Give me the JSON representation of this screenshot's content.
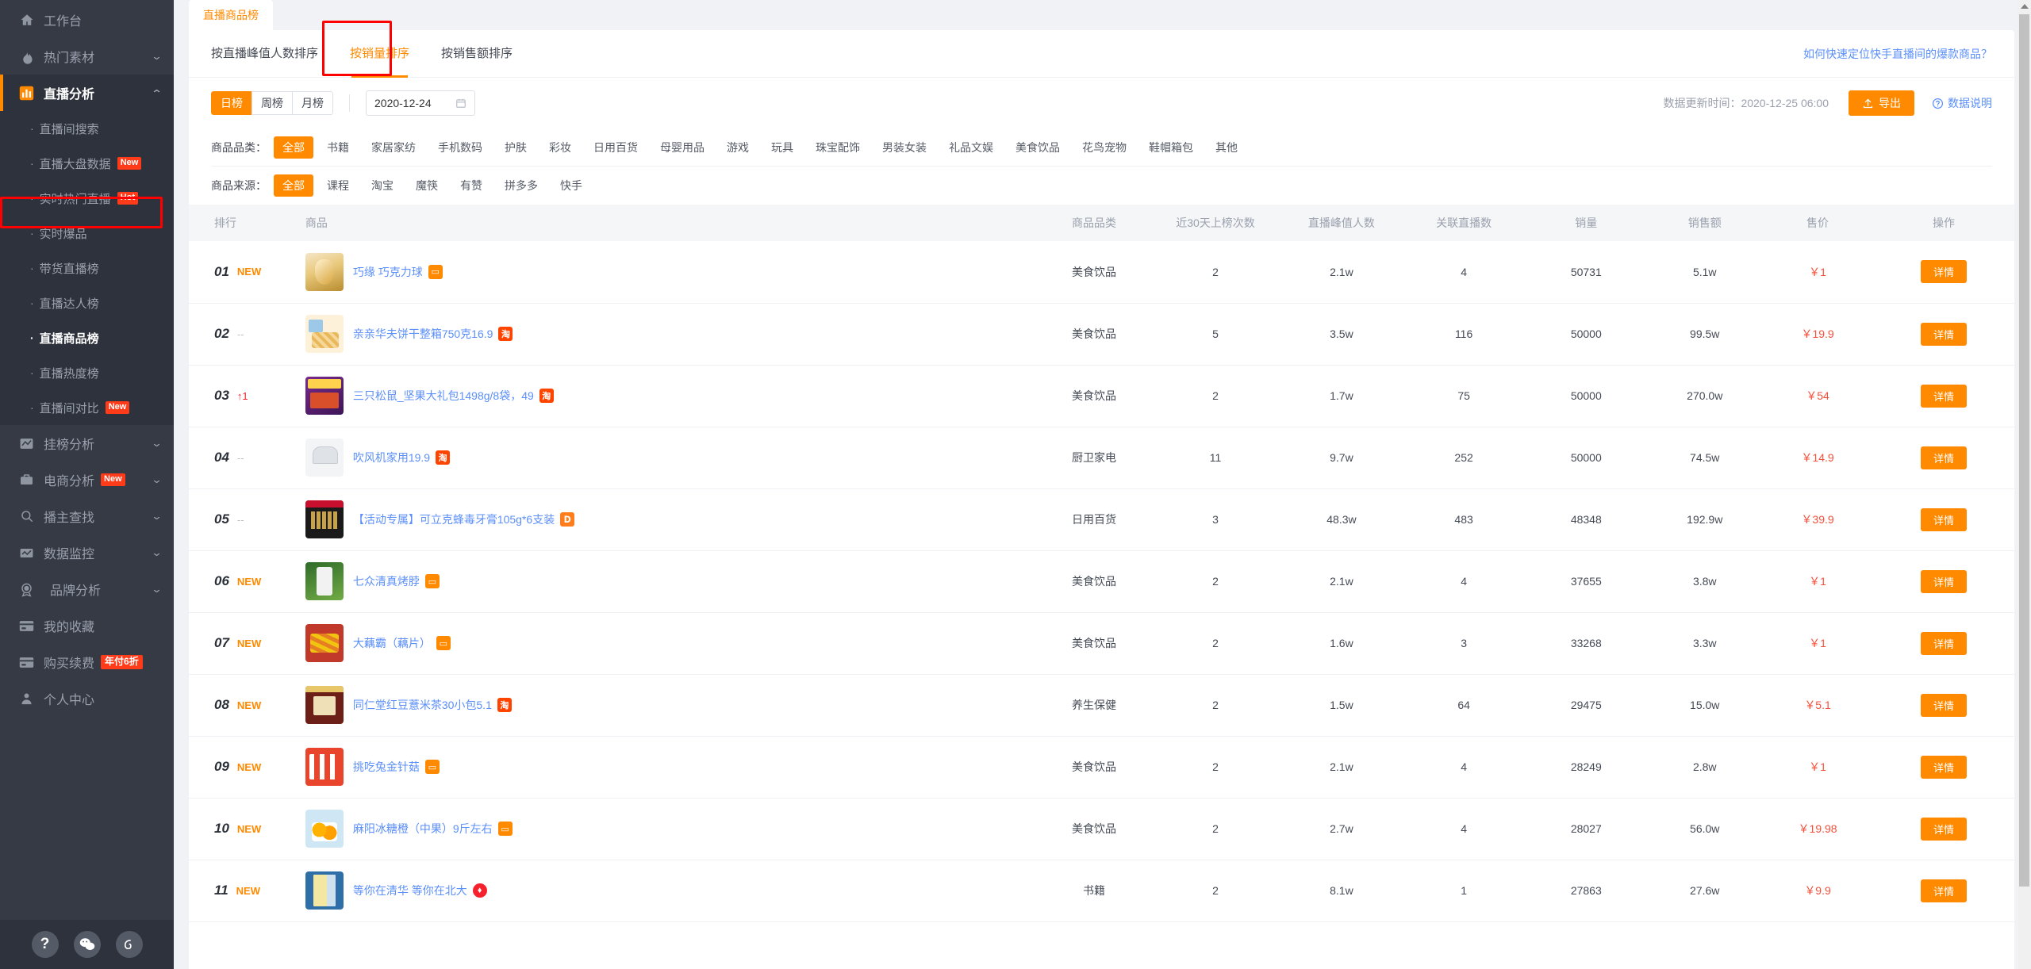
{
  "sidebar": {
    "items": [
      {
        "label": "工作台",
        "icon": "home-icon",
        "type": "group",
        "caret": false
      },
      {
        "label": "热门素材",
        "icon": "fire-icon",
        "type": "group",
        "caret": true
      },
      {
        "label": "直播分析",
        "icon": "bar-chart-icon",
        "type": "group",
        "caret": true,
        "active": true,
        "expanded": true
      }
    ],
    "live_sub_items": [
      {
        "label": "直播间搜索",
        "badge": ""
      },
      {
        "label": "直播大盘数据",
        "badge": "New"
      },
      {
        "label": "实时热门直播",
        "badge": "Hot"
      },
      {
        "label": "实时爆品",
        "badge": ""
      },
      {
        "label": "带货直播榜",
        "badge": ""
      },
      {
        "label": "直播达人榜",
        "badge": ""
      },
      {
        "label": "直播商品榜",
        "badge": "",
        "current": true
      },
      {
        "label": "直播热度榜",
        "badge": ""
      },
      {
        "label": "直播间对比",
        "badge": "New"
      }
    ],
    "lower_items": [
      {
        "label": "挂榜分析",
        "icon": "trend-icon",
        "badge": "",
        "caret": true
      },
      {
        "label": "电商分析",
        "icon": "briefcase-icon",
        "badge": "New",
        "caret": true
      },
      {
        "label": "播主查找",
        "icon": "search-icon",
        "badge": "",
        "caret": true
      },
      {
        "label": "数据监控",
        "icon": "monitor-icon",
        "badge": "",
        "caret": true
      },
      {
        "label": "品牌分析",
        "icon": "medal-icon",
        "badge": "",
        "caret": true
      },
      {
        "label": "我的收藏",
        "icon": "card-icon",
        "badge": "",
        "caret": false
      },
      {
        "label": "购买续费",
        "icon": "card-icon",
        "badge": "年付6折",
        "caret": false
      },
      {
        "label": "个人中心",
        "icon": "user-icon",
        "badge": "",
        "caret": false
      }
    ],
    "bottom_buttons": [
      {
        "name": "help-icon",
        "glyph": "?"
      },
      {
        "name": "wechat-icon",
        "glyph": ""
      },
      {
        "name": "link-icon",
        "glyph": ""
      }
    ]
  },
  "doc_tab": {
    "label": "直播商品榜"
  },
  "subtabs": [
    {
      "label": "按直播峰值人数排序",
      "active": false
    },
    {
      "label": "按销量排序",
      "active": true,
      "highlighted": true
    },
    {
      "label": "按销售额排序",
      "active": false
    }
  ],
  "help_link": "如何快速定位快手直播间的爆款商品？",
  "period": {
    "options": [
      {
        "label": "日榜",
        "active": true
      },
      {
        "label": "周榜",
        "active": false
      },
      {
        "label": "月榜",
        "active": false
      }
    ],
    "date_value": "2020-12-24"
  },
  "updated": {
    "text": "数据更新时间：2020-12-25 06:00",
    "export_label": "导出",
    "explain_label": "数据说明"
  },
  "filters": {
    "category": {
      "label": "商品品类：",
      "options": [
        "全部",
        "书籍",
        "家居家纺",
        "手机数码",
        "护肤",
        "彩妆",
        "日用百货",
        "母婴用品",
        "游戏",
        "玩具",
        "珠宝配饰",
        "男装女装",
        "礼品文娱",
        "美食饮品",
        "花鸟宠物",
        "鞋帽箱包",
        "其他"
      ],
      "selected": "全部"
    },
    "source": {
      "label": "商品来源：",
      "options": [
        "全部",
        "课程",
        "淘宝",
        "魔筷",
        "有赞",
        "拼多多",
        "快手"
      ],
      "selected": "全部"
    }
  },
  "table": {
    "headers": [
      "排行",
      "商品",
      "商品品类",
      "近30天上榜次数",
      "直播峰值人数",
      "关联直播数",
      "销量",
      "销售额",
      "售价",
      "操作"
    ],
    "action_label": "详情",
    "rows": [
      {
        "rank": "01",
        "delta": "NEW",
        "delta_type": "new",
        "name": "巧缘 巧克力球",
        "src": "shop",
        "src_glyph": "▭",
        "thumb": "t1",
        "category": "美食饮品",
        "times": "2",
        "peak": "2.1w",
        "related": "4",
        "sales": "50731",
        "amount": "5.1w",
        "price": "￥1"
      },
      {
        "rank": "02",
        "delta": "--",
        "delta_type": "dash",
        "name": "亲亲华夫饼干整箱750克16.9",
        "src": "tao",
        "src_glyph": "淘",
        "thumb": "t2",
        "category": "美食饮品",
        "times": "5",
        "peak": "3.5w",
        "related": "116",
        "sales": "50000",
        "amount": "99.5w",
        "price": "￥19.9"
      },
      {
        "rank": "03",
        "delta": "↑1",
        "delta_type": "up",
        "name": "三只松鼠_坚果大礼包1498g/8袋，49",
        "src": "tao",
        "src_glyph": "淘",
        "thumb": "t3",
        "category": "美食饮品",
        "times": "2",
        "peak": "1.7w",
        "related": "75",
        "sales": "50000",
        "amount": "270.0w",
        "price": "￥54"
      },
      {
        "rank": "04",
        "delta": "--",
        "delta_type": "dash",
        "name": "吹风机家用19.9",
        "src": "tao",
        "src_glyph": "淘",
        "thumb": "t4",
        "category": "厨卫家电",
        "times": "11",
        "peak": "9.7w",
        "related": "252",
        "sales": "50000",
        "amount": "74.5w",
        "price": "￥14.9"
      },
      {
        "rank": "05",
        "delta": "--",
        "delta_type": "dash",
        "name": "【活动专属】可立克蜂毒牙膏105g*6支装",
        "src": "mo",
        "src_glyph": "ᗞ",
        "thumb": "t5",
        "category": "日用百货",
        "times": "3",
        "peak": "48.3w",
        "related": "483",
        "sales": "48348",
        "amount": "192.9w",
        "price": "￥39.9"
      },
      {
        "rank": "06",
        "delta": "NEW",
        "delta_type": "new",
        "name": "七众清真烤脖",
        "src": "shop",
        "src_glyph": "▭",
        "thumb": "t6",
        "category": "美食饮品",
        "times": "2",
        "peak": "2.1w",
        "related": "4",
        "sales": "37655",
        "amount": "3.8w",
        "price": "￥1"
      },
      {
        "rank": "07",
        "delta": "NEW",
        "delta_type": "new",
        "name": "大藕霸（藕片）",
        "src": "shop",
        "src_glyph": "▭",
        "thumb": "t7",
        "category": "美食饮品",
        "times": "2",
        "peak": "1.6w",
        "related": "3",
        "sales": "33268",
        "amount": "3.3w",
        "price": "￥1"
      },
      {
        "rank": "08",
        "delta": "NEW",
        "delta_type": "new",
        "name": "同仁堂红豆薏米茶30小包5.1",
        "src": "tao",
        "src_glyph": "淘",
        "thumb": "t8",
        "category": "养生保健",
        "times": "2",
        "peak": "1.5w",
        "related": "64",
        "sales": "29475",
        "amount": "15.0w",
        "price": "￥5.1"
      },
      {
        "rank": "09",
        "delta": "NEW",
        "delta_type": "new",
        "name": "挑吃兔金针菇",
        "src": "shop",
        "src_glyph": "▭",
        "thumb": "t9",
        "category": "美食饮品",
        "times": "2",
        "peak": "2.1w",
        "related": "4",
        "sales": "28249",
        "amount": "2.8w",
        "price": "￥1"
      },
      {
        "rank": "10",
        "delta": "NEW",
        "delta_type": "new",
        "name": "麻阳冰糖橙（中果）9斤左右",
        "src": "shop",
        "src_glyph": "▭",
        "thumb": "t10",
        "category": "美食饮品",
        "times": "2",
        "peak": "2.7w",
        "related": "4",
        "sales": "28027",
        "amount": "56.0w",
        "price": "￥19.98"
      },
      {
        "rank": "11",
        "delta": "NEW",
        "delta_type": "new",
        "name": "等你在清华 等你在北大",
        "src": "fire",
        "src_glyph": "♦",
        "thumb": "t11",
        "category": "书籍",
        "times": "2",
        "peak": "8.1w",
        "related": "1",
        "sales": "27863",
        "amount": "27.6w",
        "price": "￥9.9"
      }
    ]
  }
}
